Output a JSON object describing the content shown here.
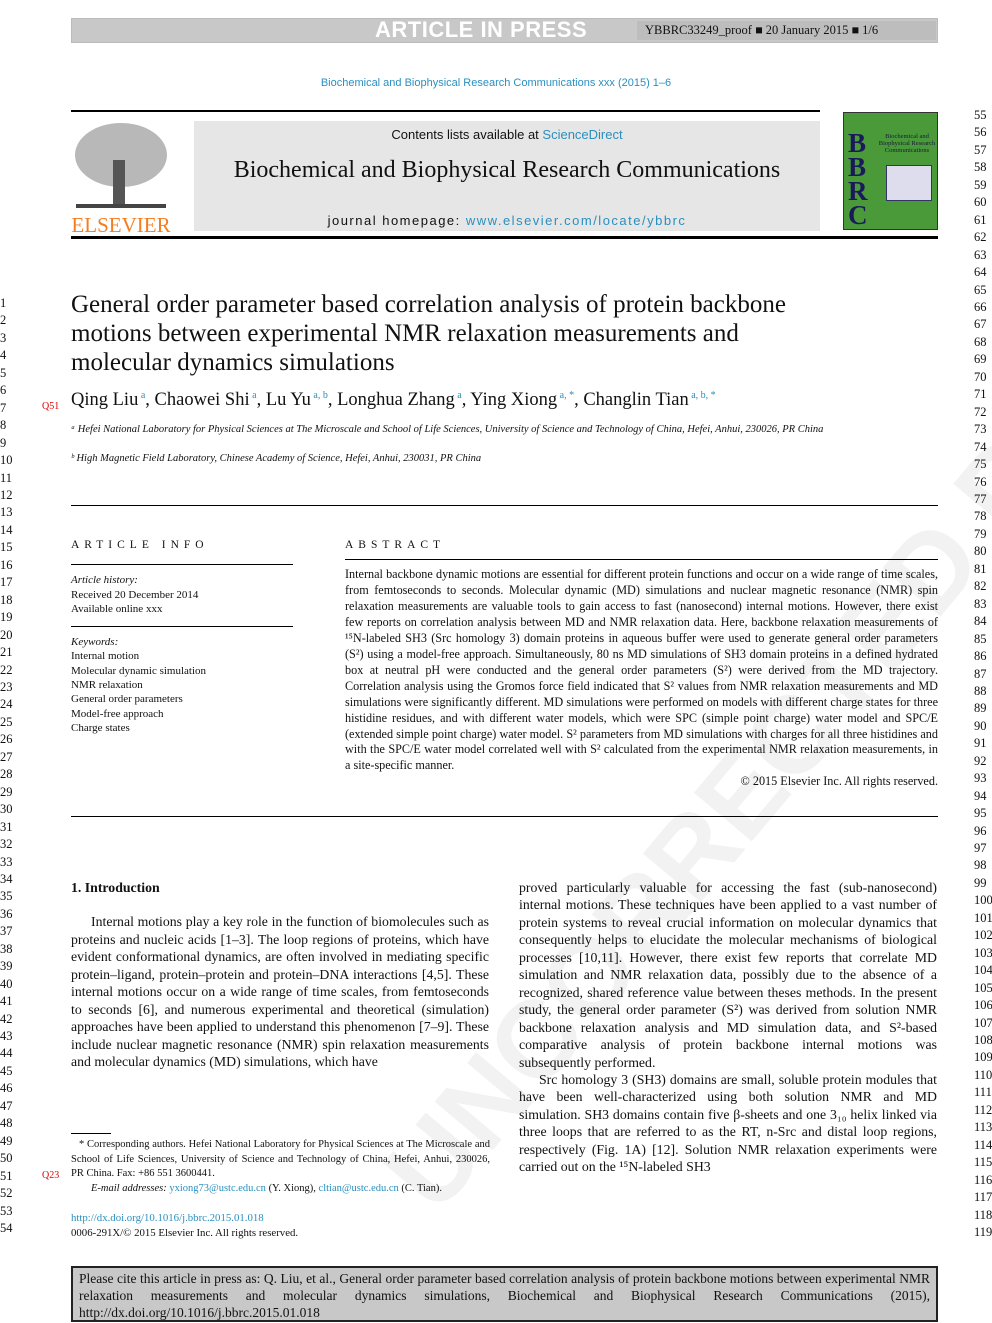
{
  "banner": {
    "status": "ARTICLE IN PRESS",
    "proof_info": "YBBRC33249_proof ■ 20 January 2015 ■ 1/6"
  },
  "journal_ref": "Biochemical and Biophysical Research Communications xxx (2015) 1–6",
  "masthead": {
    "contents_prefix": "Contents lists available at ",
    "contents_link": "ScienceDirect",
    "journal_title": "Biochemical and Biophysical Research Communications",
    "homepage_prefix": "journal homepage: ",
    "homepage_link": "www.elsevier.com/locate/ybbrc",
    "publisher": "ELSEVIER",
    "cover_letters": "BBRC",
    "cover_title": "Biochemical and Biophysical Research Communications"
  },
  "watermark": "UNCORRECTED PROOF",
  "article": {
    "title": "General order parameter based correlation analysis of protein backbone motions between experimental NMR relaxation measurements and molecular dynamics simulations",
    "query_mark": "Q51",
    "authors": [
      {
        "name": "Qing Liu",
        "sup": "a"
      },
      {
        "name": "Chaowei Shi",
        "sup": "a"
      },
      {
        "name": "Lu Yu",
        "sup": "a, b"
      },
      {
        "name": "Longhua Zhang",
        "sup": "a"
      },
      {
        "name": "Ying Xiong",
        "sup": "a, *"
      },
      {
        "name": "Changlin Tian",
        "sup": "a, b, *"
      }
    ],
    "affiliations": [
      "ᵃ Hefei National Laboratory for Physical Sciences at The Microscale and School of Life Sciences, University of Science and Technology of China, Hefei, Anhui, 230026, PR China",
      "ᵇ High Magnetic Field Laboratory, Chinese Academy of Science, Hefei, Anhui, 230031, PR China"
    ]
  },
  "article_info": {
    "heading": "ARTICLE INFO",
    "history_label": "Article history:",
    "received": "Received 20 December 2014",
    "available": "Available online xxx",
    "keywords_label": "Keywords:",
    "keywords": [
      "Internal motion",
      "Molecular dynamic simulation",
      "NMR relaxation",
      "General order parameters",
      "Model-free approach",
      "Charge states"
    ]
  },
  "abstract": {
    "heading": "ABSTRACT",
    "text": "Internal backbone dynamic motions are essential for different protein functions and occur on a wide range of time scales, from femtoseconds to seconds. Molecular dynamic (MD) simulations and nuclear magnetic resonance (NMR) spin relaxation measurements are valuable tools to gain access to fast (nanosecond) internal motions. However, there exist few reports on correlation analysis between MD and NMR relaxation data. Here, backbone relaxation measurements of ¹⁵N-labeled SH3 (Src homology 3) domain proteins in aqueous buffer were used to generate general order parameters (S²) using a model-free approach. Simultaneously, 80 ns MD simulations of SH3 domain proteins in a defined hydrated box at neutral pH were conducted and the general order parameters (S²) were derived from the MD trajectory. Correlation analysis using the Gromos force field indicated that S² values from NMR relaxation measurements and MD simulations were significantly different. MD simulations were performed on models with different charge states for three histidine residues, and with different water models, which were SPC (simple point charge) water model and SPC/E (extended simple point charge) water model. S² parameters from MD simulations with charges for all three histidines and with the SPC/E water model correlated well with S² calculated from the experimental NMR relaxation measurements, in a site-specific manner.",
    "copyright": "© 2015 Elsevier Inc. All rights reserved."
  },
  "intro": {
    "heading": "1.  Introduction",
    "left_paragraph": "Internal motions play a key role in the function of biomolecules such as proteins and nucleic acids [1–3]. The loop regions of proteins, which have evident conformational dynamics, are often involved in mediating specific protein–ligand, protein–protein and protein–DNA interactions [4,5]. These internal motions occur on a wide range of time scales, from femtoseconds to seconds [6], and numerous experimental and theoretical (simulation) approaches have been applied to understand this phenomenon [7–9]. These include nuclear magnetic resonance (NMR) spin relaxation measurements and molecular dynamics (MD) simulations, which have",
    "right_paragraph_1": "proved particularly valuable for accessing the fast (sub-nanosecond) internal motions. These techniques have been applied to a vast number of protein systems to reveal crucial information on molecular dynamics that consequently helps to elucidate the molecular mechanisms of biological processes [10,11]. However, there exist few reports that correlate MD simulation and NMR relaxation data, possibly due to the absence of a recognized, shared reference value between theses methods. In the present study, the general order parameter (S²) was derived from solution NMR backbone relaxation analysis and MD simulation data, and S²-based comparative analysis of protein backbone internal motions was subsequently performed.",
    "right_paragraph_2": "Src homology 3 (SH3) domains are small, soluble protein modules that have been well-characterized using both solution NMR and MD simulation. SH3 domains contain five β-sheets and one 3₁₀ helix linked via three loops that are referred to as the RT, n-Src and distal loop regions, respectively (Fig. 1A) [12]. Solution NMR relaxation experiments were carried out on the ¹⁵N-labeled SH3"
  },
  "footnote": {
    "corresponding": "* Corresponding authors. Hefei National Laboratory for Physical Sciences at The Microscale and School of Life Sciences, University of Science and Technology of China, Hefei, Anhui, 230026, PR China. Fax: +86 551 3600441.",
    "email_label": "E-mail addresses: ",
    "email1": "yxiong73@ustc.edu.cn",
    "email1_owner": " (Y. Xiong), ",
    "email2": "cltian@ustc.edu.cn",
    "email2_owner": " (C. Tian).",
    "query_mark": "Q23",
    "doi": "http://dx.doi.org/10.1016/j.bbrc.2015.01.018",
    "issn": "0006-291X/© 2015 Elsevier Inc. All rights reserved."
  },
  "citation_box": "Please cite this article in press as: Q. Liu, et al., General order parameter based correlation analysis of protein backbone motions between experimental NMR relaxation measurements and molecular dynamics simulations, Biochemical and Biophysical Research Communications (2015), http://dx.doi.org/10.1016/j.bbrc.2015.01.018",
  "line_numbers": {
    "left_start": 1,
    "left_end": 54,
    "right_start": 55,
    "right_end": 119
  },
  "colors": {
    "link": "#2a8fbf",
    "elsevier_orange": "#f47d20",
    "cover_green": "#4a9a3a",
    "banner_gray": "#c8c8c8"
  }
}
